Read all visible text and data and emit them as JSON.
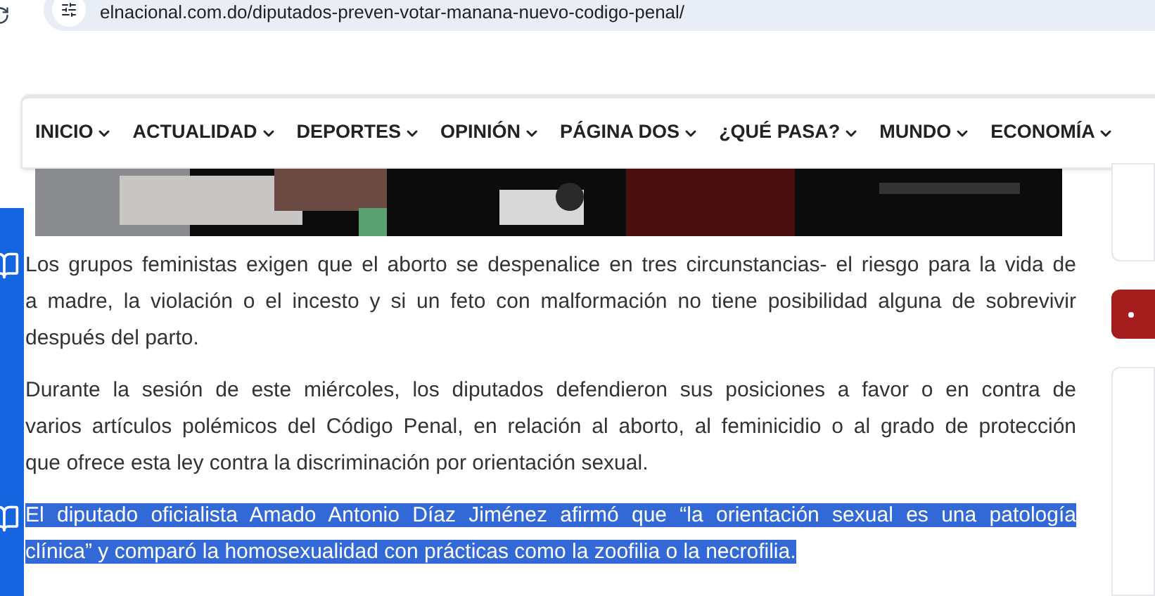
{
  "address_bar": {
    "url": "elnacional.com.do/diputados-preven-votar-manana-nuevo-codigo-penal/"
  },
  "nav": {
    "items": [
      {
        "label": "INICIO"
      },
      {
        "label": "ACTUALIDAD"
      },
      {
        "label": "DEPORTES"
      },
      {
        "label": "OPINIÓN"
      },
      {
        "label": "PÁGINA DOS"
      },
      {
        "label": "¿QUÉ PASA?"
      },
      {
        "label": "MUNDO"
      },
      {
        "label": "ECONOMÍA"
      }
    ]
  },
  "article": {
    "paragraphs": [
      {
        "selected": false,
        "lines": [
          "Los grupos feministas exigen que el aborto se despenalice en tres circunstancias- el riesgo para la vida de",
          "a madre, la violación o el incesto y si un feto con malformación no tiene posibilidad alguna de sobrevivir",
          "después del parto."
        ]
      },
      {
        "selected": false,
        "lines": [
          "Durante la sesión de este miércoles, los diputados defendieron sus posiciones a favor o en contra de",
          "varios artículos polémicos del Código Penal, en relación al aborto, al feminicidio o al grado de protección",
          "que ofrece esta ley contra la discriminación por orientación sexual."
        ]
      },
      {
        "selected": true,
        "lines": [
          "El diputado oficialista Amado Antonio Díaz Jiménez afirmó que “la orientación sexual es una patología",
          "clínica” y comparó la homosexualidad con prácticas como la zoofilia o la necrofilia."
        ]
      }
    ]
  }
}
